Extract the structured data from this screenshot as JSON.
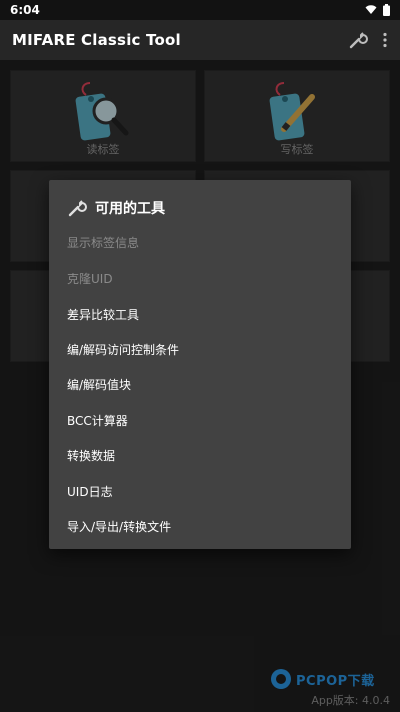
{
  "status": {
    "time": "6:04"
  },
  "app": {
    "title": "MIFARE Classic Tool"
  },
  "tiles": [
    {
      "label": "读标签"
    },
    {
      "label": "写标签"
    }
  ],
  "dialog": {
    "title": "可用的工具",
    "items": [
      {
        "label": "显示标签信息",
        "enabled": false
      },
      {
        "label": "克隆UID",
        "enabled": false
      },
      {
        "label": "差异比较工具",
        "enabled": true
      },
      {
        "label": "编/解码访问控制条件",
        "enabled": true
      },
      {
        "label": "编/解码值块",
        "enabled": true
      },
      {
        "label": "BCC计算器",
        "enabled": true
      },
      {
        "label": "转换数据",
        "enabled": true
      },
      {
        "label": "UID日志",
        "enabled": true
      },
      {
        "label": "导入/导出/转换文件",
        "enabled": true
      }
    ]
  },
  "footer": {
    "version": "App版本: 4.0.4"
  },
  "watermark": {
    "text": "PCPOP下载"
  },
  "colors": {
    "tag": "#5bb3c9",
    "pin": "#e0445a",
    "accent": "#2ea7ff"
  }
}
